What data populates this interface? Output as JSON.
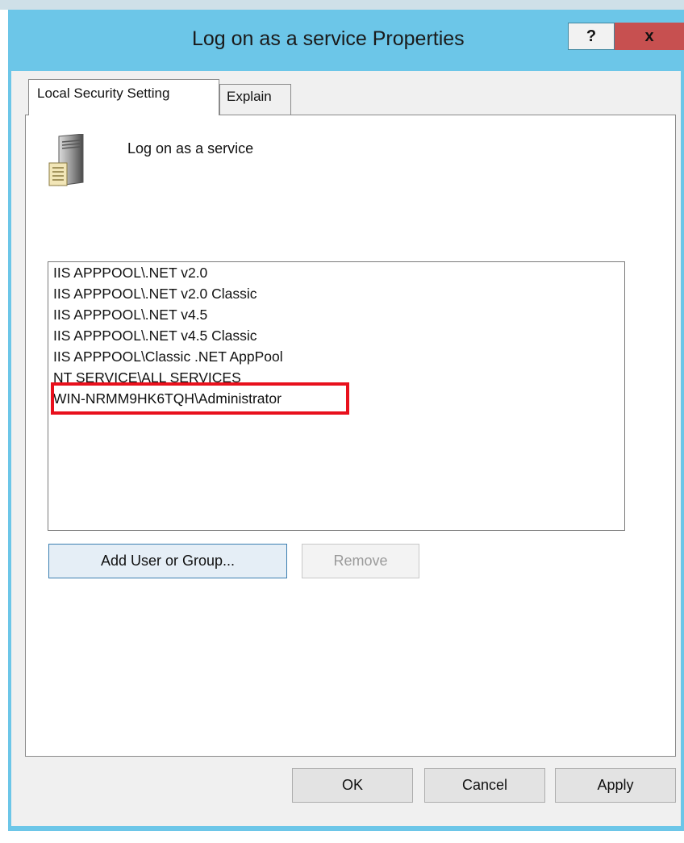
{
  "window": {
    "title": "Log on as a service Properties",
    "help_label": "?",
    "close_label": "x"
  },
  "tabs": [
    {
      "label": "Local Security Setting",
      "active": true
    },
    {
      "label": "Explain",
      "active": false
    }
  ],
  "policy": {
    "name": "Log on as a service",
    "icon": "server-icon"
  },
  "accounts": [
    "IIS APPPOOL\\.NET v2.0",
    "IIS APPPOOL\\.NET v2.0 Classic",
    "IIS APPPOOL\\.NET v4.5",
    "IIS APPPOOL\\.NET v4.5 Classic",
    "IIS APPPOOL\\Classic .NET AppPool",
    "NT SERVICE\\ALL SERVICES",
    "WIN-NRMM9HK6TQH\\Administrator"
  ],
  "highlighted_account_index": 6,
  "buttons": {
    "add_label": "Add User or Group...",
    "remove_label": "Remove",
    "ok_label": "OK",
    "cancel_label": "Cancel",
    "apply_label": "Apply"
  },
  "colors": {
    "window_frame": "#6cc6e8",
    "close_button": "#c75050",
    "highlight_border": "#e8101c"
  }
}
